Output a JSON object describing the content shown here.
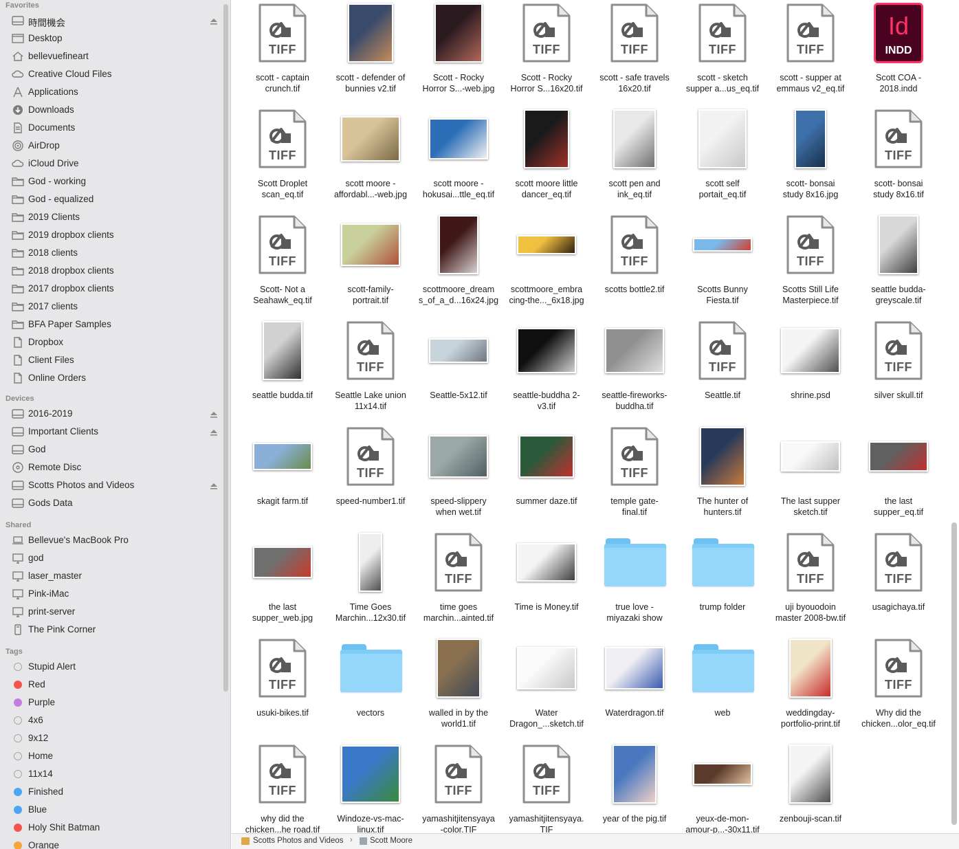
{
  "sidebar": {
    "favorites_title": "Favorites",
    "favorites": [
      {
        "label": "時間機会",
        "icon": "drive-icon",
        "eject": true
      },
      {
        "label": "Desktop",
        "icon": "desktop-icon"
      },
      {
        "label": "bellevuefineart",
        "icon": "home-icon"
      },
      {
        "label": "Creative Cloud Files",
        "icon": "creative-cloud-icon"
      },
      {
        "label": "Applications",
        "icon": "applications-icon"
      },
      {
        "label": "Downloads",
        "icon": "downloads-icon"
      },
      {
        "label": "Documents",
        "icon": "documents-icon"
      },
      {
        "label": "AirDrop",
        "icon": "airdrop-icon"
      },
      {
        "label": "iCloud Drive",
        "icon": "cloud-icon"
      },
      {
        "label": "God - working",
        "icon": "folder-icon"
      },
      {
        "label": "God - equalized",
        "icon": "folder-icon"
      },
      {
        "label": "2019 Clients",
        "icon": "folder-icon"
      },
      {
        "label": "2019 dropbox clients",
        "icon": "folder-icon"
      },
      {
        "label": "2018 clients",
        "icon": "folder-icon"
      },
      {
        "label": "2018 dropbox clients",
        "icon": "folder-icon"
      },
      {
        "label": "2017 dropbox clients",
        "icon": "folder-icon"
      },
      {
        "label": "2017 clients",
        "icon": "folder-icon"
      },
      {
        "label": "BFA Paper Samples",
        "icon": "folder-icon"
      },
      {
        "label": "Dropbox",
        "icon": "document-icon"
      },
      {
        "label": "Client Files",
        "icon": "document-icon"
      },
      {
        "label": "Online Orders",
        "icon": "document-icon"
      }
    ],
    "devices_title": "Devices",
    "devices": [
      {
        "label": "2016-2019",
        "icon": "drive-icon",
        "eject": true
      },
      {
        "label": "Important Clients",
        "icon": "drive-icon",
        "eject": true
      },
      {
        "label": "God",
        "icon": "drive-icon"
      },
      {
        "label": "Remote Disc",
        "icon": "disc-icon"
      },
      {
        "label": "Scotts Photos and Videos",
        "icon": "drive-icon",
        "eject": true
      },
      {
        "label": "Gods Data",
        "icon": "drive-icon"
      }
    ],
    "shared_title": "Shared",
    "shared": [
      {
        "label": "Bellevue's MacBook Pro",
        "icon": "laptop-icon"
      },
      {
        "label": "god",
        "icon": "monitor-icon"
      },
      {
        "label": "laser_master",
        "icon": "monitor-icon"
      },
      {
        "label": "Pink-iMac",
        "icon": "monitor-icon"
      },
      {
        "label": "print-server",
        "icon": "monitor-icon"
      },
      {
        "label": "The Pink Corner",
        "icon": "server-icon"
      }
    ],
    "tags_title": "Tags",
    "tags": [
      {
        "label": "Stupid Alert",
        "color": "#e7e6e8",
        "outline": true
      },
      {
        "label": "Red",
        "color": "#f5544c"
      },
      {
        "label": "Purple",
        "color": "#c37ce0"
      },
      {
        "label": "4x6",
        "color": "#e7e6e8",
        "outline": true
      },
      {
        "label": "9x12",
        "color": "#e7e6e8",
        "outline": true
      },
      {
        "label": "Home",
        "color": "#e7e6e8",
        "outline": true
      },
      {
        "label": "11x14",
        "color": "#e7e6e8",
        "outline": true
      },
      {
        "label": "Finished",
        "color": "#4ea3f5"
      },
      {
        "label": "Blue",
        "color": "#4ea3f5"
      },
      {
        "label": "Holy Shit Batman",
        "color": "#f5544c"
      },
      {
        "label": "Orange",
        "color": "#f7a43a"
      }
    ]
  },
  "files": [
    {
      "l1": "scott - captain",
      "l2": "crunch.tif",
      "kind": "tiff"
    },
    {
      "l1": "scott - defender of",
      "l2": "bunnies v2.tif",
      "kind": "img",
      "w": 66,
      "h": 86,
      "c1": "#3a4a6a",
      "c2": "#c58c5a"
    },
    {
      "l1": "Scott - Rocky",
      "l2": "Horror S...-web.jpg",
      "kind": "img",
      "w": 70,
      "h": 86,
      "c1": "#2b1a20",
      "c2": "#b0685a"
    },
    {
      "l1": "Scott - Rocky",
      "l2": "Horror S...16x20.tif",
      "kind": "tiff"
    },
    {
      "l1": "scott - safe travels",
      "l2": "16x20.tif",
      "kind": "tiff"
    },
    {
      "l1": "scott - sketch",
      "l2": "supper a...us_eq.tif",
      "kind": "tiff"
    },
    {
      "l1": "scott - supper at",
      "l2": "emmaus v2_eq.tif",
      "kind": "tiff"
    },
    {
      "l1": "Scott COA -",
      "l2": "2018.indd",
      "kind": "indd",
      "indd_big": "Id",
      "indd_small": "INDD"
    },
    {
      "l1": "Scott Droplet",
      "l2": "scan_eq.tif",
      "kind": "tiff"
    },
    {
      "l1": "scott moore -",
      "l2": "affordabl...-web.jpg",
      "kind": "img",
      "w": 86,
      "h": 66,
      "c1": "#d9c49a",
      "c2": "#7a6a44"
    },
    {
      "l1": "scott moore -",
      "l2": "hokusai...ttle_eq.tif",
      "kind": "img",
      "w": 86,
      "h": 60,
      "c1": "#2c6eb8",
      "c2": "#f0f0f0"
    },
    {
      "l1": "scott moore little",
      "l2": "dancer_eq.tif",
      "kind": "img",
      "w": 66,
      "h": 86,
      "c1": "#1a1a1a",
      "c2": "#a0302a"
    },
    {
      "l1": "scott pen and",
      "l2": "ink_eq.tif",
      "kind": "img",
      "w": 62,
      "h": 86,
      "c1": "#e8e8e8",
      "c2": "#707070"
    },
    {
      "l1": "scott self",
      "l2": "portait_eq.tif",
      "kind": "img",
      "w": 70,
      "h": 86,
      "c1": "#f2f2f2",
      "c2": "#c8c8c8"
    },
    {
      "l1": "scott- bonsai",
      "l2": "study 8x16.jpg",
      "kind": "img",
      "w": 46,
      "h": 86,
      "c1": "#3d6fa8",
      "c2": "#18304a"
    },
    {
      "l1": "scott- bonsai",
      "l2": "study 8x16.tif",
      "kind": "tiff"
    },
    {
      "l1": "Scott- Not a",
      "l2": "Seahawk_eq.tif",
      "kind": "tiff"
    },
    {
      "l1": "scott-family-",
      "l2": "portrait.tif",
      "kind": "img",
      "w": 86,
      "h": 62,
      "c1": "#c8cf9a",
      "c2": "#b0503a"
    },
    {
      "l1": "scottmoore_dream",
      "l2": "s_of_a_d...16x24.jpg",
      "kind": "img",
      "w": 58,
      "h": 86,
      "c1": "#401818",
      "c2": "#d8d0d0"
    },
    {
      "l1": "scottmoore_embra",
      "l2": "cing-the..._6x18.jpg",
      "kind": "img",
      "w": 86,
      "h": 28,
      "c1": "#f0c040",
      "c2": "#302010"
    },
    {
      "l1": "scotts bottle2.tif",
      "l2": "",
      "kind": "tiff"
    },
    {
      "l1": "Scotts Bunny",
      "l2": "Fiesta.tif",
      "kind": "img",
      "w": 86,
      "h": 20,
      "c1": "#7ab8e8",
      "c2": "#d04030"
    },
    {
      "l1": "Scotts Still Life",
      "l2": "Masterpiece.tif",
      "kind": "tiff"
    },
    {
      "l1": "seattle budda-",
      "l2": "greyscale.tif",
      "kind": "img",
      "w": 58,
      "h": 86,
      "c1": "#d8d8d8",
      "c2": "#404040"
    },
    {
      "l1": "seattle budda.tif",
      "l2": "",
      "kind": "img",
      "w": 58,
      "h": 86,
      "c1": "#d0d0d0",
      "c2": "#303030"
    },
    {
      "l1": "Seattle Lake union",
      "l2": "11x14.tif",
      "kind": "tiff"
    },
    {
      "l1": "Seattle-5x12.tif",
      "l2": "",
      "kind": "img",
      "w": 86,
      "h": 36,
      "c1": "#c8d4dc",
      "c2": "#707880"
    },
    {
      "l1": "seattle-buddha 2-",
      "l2": "v3.tif",
      "kind": "img",
      "w": 86,
      "h": 66,
      "c1": "#101010",
      "c2": "#d0d0d0"
    },
    {
      "l1": "seattle-fireworks-",
      "l2": "buddha.tif",
      "kind": "img",
      "w": 86,
      "h": 66,
      "c1": "#909090",
      "c2": "#e0e0e0"
    },
    {
      "l1": "Seattle.tif",
      "l2": "",
      "kind": "tiff"
    },
    {
      "l1": "shrine.psd",
      "l2": "",
      "kind": "img",
      "w": 86,
      "h": 66,
      "c1": "#f4f4f4",
      "c2": "#505050"
    },
    {
      "l1": "silver skull.tif",
      "l2": "",
      "kind": "tiff"
    },
    {
      "l1": "skagit farm.tif",
      "l2": "",
      "kind": "img",
      "w": 86,
      "h": 40,
      "c1": "#8ab0d8",
      "c2": "#6a8a4a"
    },
    {
      "l1": "speed-number1.tif",
      "l2": "",
      "kind": "tiff"
    },
    {
      "l1": "speed-slippery",
      "l2": "when wet.tif",
      "kind": "img",
      "w": 86,
      "h": 62,
      "c1": "#9aa8a8",
      "c2": "#506060"
    },
    {
      "l1": "summer daze.tif",
      "l2": "",
      "kind": "img",
      "w": 80,
      "h": 62,
      "c1": "#2a5a3a",
      "c2": "#c03030"
    },
    {
      "l1": "temple gate-",
      "l2": "final.tif",
      "kind": "tiff"
    },
    {
      "l1": "The hunter of",
      "l2": "hunters.tif",
      "kind": "img",
      "w": 66,
      "h": 86,
      "c1": "#2a3a5a",
      "c2": "#c87a3a"
    },
    {
      "l1": "The last supper",
      "l2": "sketch.tif",
      "kind": "img",
      "w": 86,
      "h": 44,
      "c1": "#f8f8f8",
      "c2": "#c0c0c0"
    },
    {
      "l1": "the last",
      "l2": "supper_eq.tif",
      "kind": "img",
      "w": 86,
      "h": 44,
      "c1": "#606060",
      "c2": "#c03030"
    },
    {
      "l1": "the last",
      "l2": "supper_web.jpg",
      "kind": "img",
      "w": 86,
      "h": 46,
      "c1": "#707070",
      "c2": "#c83a2a"
    },
    {
      "l1": "Time Goes",
      "l2": "Marchin...12x30.tif",
      "kind": "img",
      "w": 34,
      "h": 86,
      "c1": "#eeeeee",
      "c2": "#505050"
    },
    {
      "l1": "time goes",
      "l2": "marchin...ainted.tif",
      "kind": "tiff"
    },
    {
      "l1": "Time is Money.tif",
      "l2": "",
      "kind": "img",
      "w": 86,
      "h": 56,
      "c1": "#f4f4f4",
      "c2": "#404040"
    },
    {
      "l1": "true love -",
      "l2": "miyazaki show",
      "kind": "folder"
    },
    {
      "l1": "trump folder",
      "l2": "",
      "kind": "folder"
    },
    {
      "l1": "uji byouodoin",
      "l2": "master 2008-bw.tif",
      "kind": "tiff"
    },
    {
      "l1": "usagichaya.tif",
      "l2": "",
      "kind": "tiff"
    },
    {
      "l1": "usuki-bikes.tif",
      "l2": "",
      "kind": "tiff"
    },
    {
      "l1": "vectors",
      "l2": "",
      "kind": "folder"
    },
    {
      "l1": "walled in by the",
      "l2": "world1.tif",
      "kind": "img",
      "w": 64,
      "h": 86,
      "c1": "#8a7050",
      "c2": "#404858"
    },
    {
      "l1": "Water",
      "l2": "Dragon_...sketch.tif",
      "kind": "img",
      "w": 86,
      "h": 62,
      "c1": "#fafafa",
      "c2": "#c8c8c8"
    },
    {
      "l1": "Waterdragon.tif",
      "l2": "",
      "kind": "img",
      "w": 86,
      "h": 62,
      "c1": "#f0f0f4",
      "c2": "#3a5ab0"
    },
    {
      "l1": "web",
      "l2": "",
      "kind": "folder"
    },
    {
      "l1": "weddingday-",
      "l2": "portfolio-print.tif",
      "kind": "img",
      "w": 62,
      "h": 86,
      "c1": "#f0e4c8",
      "c2": "#c82a2a"
    },
    {
      "l1": "Why did the",
      "l2": "chicken...olor_eq.tif",
      "kind": "tiff"
    },
    {
      "l1": "why did the",
      "l2": "chicken...he road.tif",
      "kind": "tiff"
    },
    {
      "l1": "Windoze-vs-mac-",
      "l2": "linux.tif",
      "kind": "img",
      "w": 86,
      "h": 84,
      "c1": "#3a78c8",
      "c2": "#3a8a3a"
    },
    {
      "l1": "yamashitjitensyaya",
      "l2": "-color.TIF",
      "kind": "tiff"
    },
    {
      "l1": "yamashitjitensyaya.",
      "l2": "TIF",
      "kind": "tiff"
    },
    {
      "l1": "year of the pig.tif",
      "l2": "",
      "kind": "img",
      "w": 64,
      "h": 86,
      "c1": "#4a78c0",
      "c2": "#f0d0c8"
    },
    {
      "l1": "yeux-de-mon-",
      "l2": "amour-p...-30x11.tif",
      "kind": "img",
      "w": 86,
      "h": 32,
      "c1": "#5a3a2a",
      "c2": "#e0c0a0"
    },
    {
      "l1": "zenbouji-scan.tif",
      "l2": "",
      "kind": "img",
      "w": 62,
      "h": 86,
      "c1": "#f4f4f4",
      "c2": "#505050"
    }
  ],
  "tiff_label": "TIFF",
  "pathbar": {
    "segment1": "Scotts Photos and Videos",
    "separator": "›",
    "segment2": "Scott Moore"
  }
}
